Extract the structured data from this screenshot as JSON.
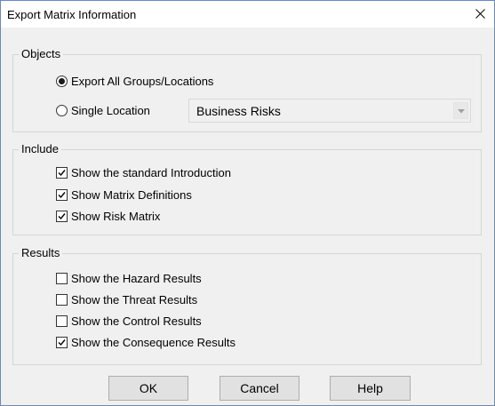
{
  "window": {
    "title": "Export Matrix Information"
  },
  "objects": {
    "title": "Objects",
    "export_all_label": "Export All Groups/Locations",
    "single_location_label": "Single Location",
    "location_value": "Business Risks",
    "selected": "export_all"
  },
  "include": {
    "title": "Include",
    "items": [
      {
        "label": "Show the standard Introduction",
        "checked": true
      },
      {
        "label": "Show Matrix Definitions",
        "checked": true
      },
      {
        "label": "Show Risk Matrix",
        "checked": true
      }
    ]
  },
  "results": {
    "title": "Results",
    "items": [
      {
        "label": "Show the Hazard Results",
        "checked": false
      },
      {
        "label": "Show the Threat Results",
        "checked": false
      },
      {
        "label": "Show the Control Results",
        "checked": false
      },
      {
        "label": "Show the Consequence Results",
        "checked": true
      }
    ]
  },
  "buttons": {
    "ok": "OK",
    "cancel": "Cancel",
    "help": "Help"
  },
  "icons": {
    "close": "close-icon",
    "dropdown": "chevron-down-icon"
  }
}
